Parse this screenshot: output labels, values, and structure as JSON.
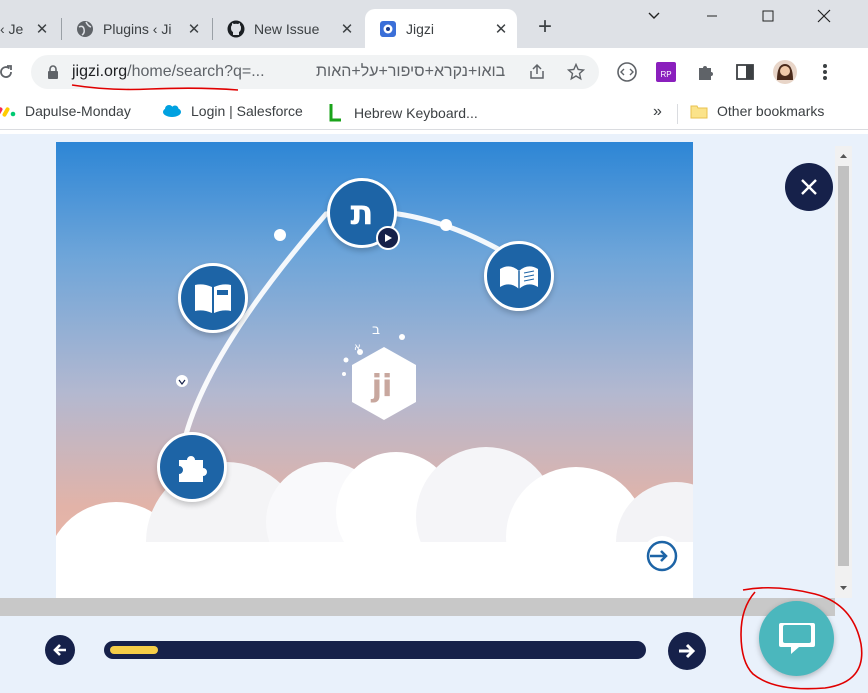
{
  "browser": {
    "tabs": [
      {
        "title": "‹ Je",
        "icon": "wordpress-icon"
      },
      {
        "title": "Plugins ‹ Ji",
        "icon": "globe-icon"
      },
      {
        "title": "New Issue",
        "icon": "github-icon"
      },
      {
        "title": "Jigzi",
        "icon": "jigzi-icon",
        "active": true
      }
    ],
    "url_host": "jigzi.org",
    "url_path": "/home/search?q=...",
    "url_query_rtl": "בואו+נקרא+סיפור+על+האות",
    "bookmarks": [
      "Dapulse-Monday",
      "Login | Salesforce",
      "Hebrew Keyboard..."
    ],
    "overflow": "»",
    "other_bookmarks": "Other bookmarks"
  },
  "game": {
    "center_logo": "ji",
    "top_node_letter": "ת"
  },
  "progress": {
    "value": 0.09
  },
  "colors": {
    "navy": "#16214a",
    "accent_yellow": "#f5cd47",
    "chat_teal": "#4bb7bd",
    "annotation_red": "#e00000"
  }
}
